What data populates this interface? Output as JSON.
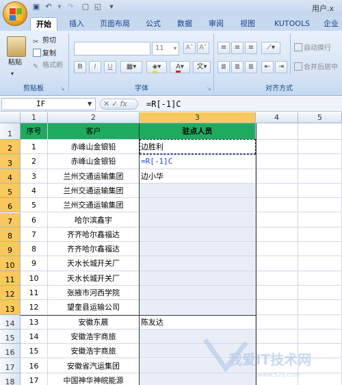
{
  "window": {
    "title": "用户.x"
  },
  "quick_access": {
    "save_icon": "save-icon",
    "undo_icon": "undo-icon",
    "redo_icon": "redo-icon"
  },
  "tabs": [
    {
      "label": "开始",
      "active": true
    },
    {
      "label": "插入"
    },
    {
      "label": "页面布局"
    },
    {
      "label": "公式"
    },
    {
      "label": "数据"
    },
    {
      "label": "审阅"
    },
    {
      "label": "视图"
    },
    {
      "label": "KUTOOLS"
    },
    {
      "label": "企业"
    }
  ],
  "ribbon": {
    "clipboard": {
      "label": "剪贴板",
      "paste": "粘贴",
      "cut": "剪切",
      "copy": "复制",
      "format_painter": "格式刷"
    },
    "font": {
      "label": "字体",
      "font_name": "",
      "font_size": "11",
      "bold": "B",
      "italic": "I",
      "underline": "U"
    },
    "alignment": {
      "label": "对齐方式",
      "wrap_text": "自动换行",
      "merge_center": "合并后居中"
    }
  },
  "formula_bar": {
    "name_box": "IF",
    "formula": "=R[-1]C",
    "fx": "fx"
  },
  "columns": [
    "1",
    "2",
    "3",
    "4",
    "5"
  ],
  "header_row": {
    "col1": "序号",
    "col2": "客户",
    "col3": "驻点人员"
  },
  "rows": [
    {
      "row": "2",
      "no": "1",
      "client": "赤峰山金银铅",
      "staff": "边胜利"
    },
    {
      "row": "3",
      "no": "2",
      "client": "赤峰山金银铅",
      "staff": "=R[-1]C"
    },
    {
      "row": "4",
      "no": "3",
      "client": "兰州交通运输集团",
      "staff": "边小华"
    },
    {
      "row": "5",
      "no": "4",
      "client": "兰州交通运输集团",
      "staff": ""
    },
    {
      "row": "6",
      "no": "5",
      "client": "兰州交通运输集团",
      "staff": ""
    },
    {
      "row": "7",
      "no": "6",
      "client": "哈尔滨鑫宇",
      "staff": ""
    },
    {
      "row": "8",
      "no": "7",
      "client": "齐齐哈尔鑫福达",
      "staff": ""
    },
    {
      "row": "9",
      "no": "8",
      "client": "齐齐哈尔鑫福达",
      "staff": ""
    },
    {
      "row": "10",
      "no": "9",
      "client": "天水长城开关厂",
      "staff": ""
    },
    {
      "row": "11",
      "no": "10",
      "client": "天水长城开关厂",
      "staff": ""
    },
    {
      "row": "12",
      "no": "11",
      "client": "张掖市河西学院",
      "staff": ""
    },
    {
      "row": "13",
      "no": "12",
      "client": "望奎县运输公司",
      "staff": ""
    },
    {
      "row": "14",
      "no": "13",
      "client": "安徽东晨",
      "staff": "陈友达"
    },
    {
      "row": "15",
      "no": "14",
      "client": "安徽浩宇商旅",
      "staff": ""
    },
    {
      "row": "16",
      "no": "15",
      "client": "安徽浩宇商旅",
      "staff": ""
    },
    {
      "row": "17",
      "no": "16",
      "client": "安徽省汽运集团",
      "staff": ""
    },
    {
      "row": "18",
      "no": "17",
      "client": "中国神华神皖能源",
      "staff": ""
    }
  ],
  "watermark": {
    "text": "我爱IT技术网",
    "url": "www.52ij.com"
  },
  "colors": {
    "header_green": "#1fab5f",
    "selection_orange": "#f9c85e",
    "formula_blue": "#1f3fd0"
  }
}
